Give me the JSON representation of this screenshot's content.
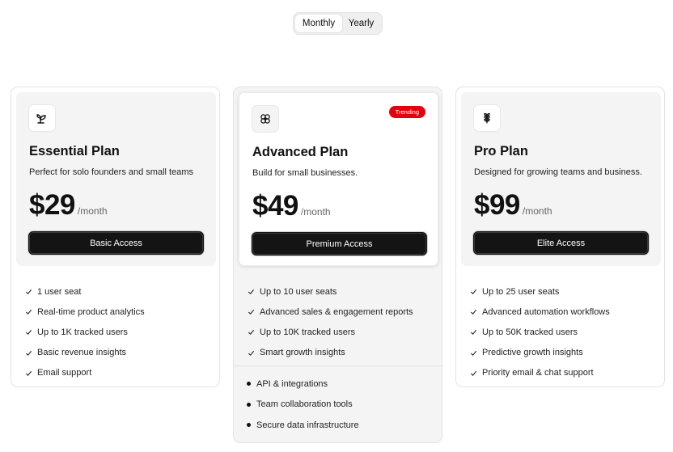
{
  "billing_toggle": {
    "monthly": "Monthly",
    "yearly": "Yearly",
    "selected": "Monthly"
  },
  "plans": [
    {
      "icon": "sprout-icon",
      "name": "Essential Plan",
      "description": "Perfect for solo founders and small teams",
      "price": "$29",
      "period": "/month",
      "cta": "Basic Access",
      "features": [
        "1 user seat",
        "Real-time product analytics",
        "Up to 1K tracked users",
        "Basic revenue insights",
        "Email support"
      ]
    },
    {
      "icon": "flower-icon",
      "badge": "Trending",
      "name": "Advanced Plan",
      "description": "Build for small businesses.",
      "price": "$49",
      "period": "/month",
      "cta": "Premium Access",
      "features": [
        "Up to 10 user seats",
        "Advanced sales & engagement reports",
        "Up to 10K tracked users",
        "Smart growth insights"
      ],
      "extras": [
        "API & integrations",
        "Team collaboration tools",
        "Secure data infrastructure"
      ]
    },
    {
      "icon": "leaf-stack-icon",
      "name": "Pro Plan",
      "description": "Designed for growing teams and business.",
      "price": "$99",
      "period": "/month",
      "cta": "Elite Access",
      "features": [
        "Up to 25 user seats",
        "Advanced automation workflows",
        "Up to 50K tracked users",
        "Predictive growth insights",
        "Priority email & chat support"
      ]
    }
  ],
  "colors": {
    "badge": "#e3000f",
    "button": "#141414",
    "panel": "#f4f4f4"
  }
}
